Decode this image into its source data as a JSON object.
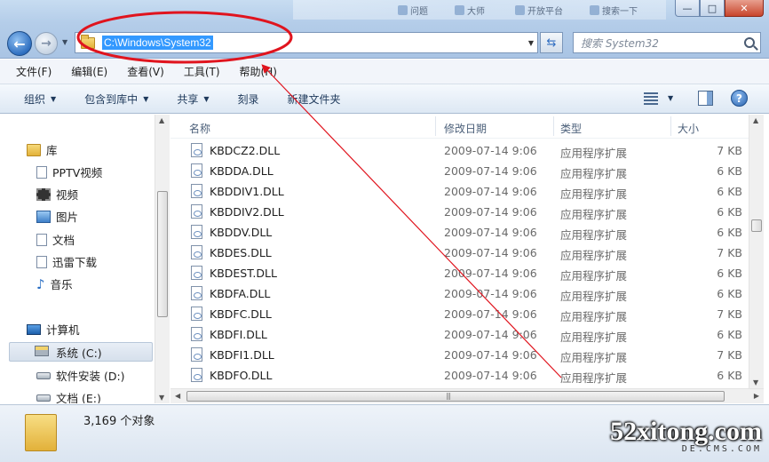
{
  "titlebar": {
    "blur_tabs": [
      "问题",
      "大师",
      "开放平台",
      "搜索一下"
    ],
    "min_glyph": "—",
    "max_glyph": "□",
    "close_glyph": "✕"
  },
  "address": {
    "path": "C:\\Windows\\System32",
    "search_placeholder": "搜索 System32"
  },
  "menu": [
    "文件(F)",
    "编辑(E)",
    "查看(V)",
    "工具(T)",
    "帮助(H)"
  ],
  "toolbar": {
    "organize": "组织",
    "include_library": "包含到库中",
    "share": "共享",
    "burn": "刻录",
    "new_folder": "新建文件夹",
    "help_glyph": "?"
  },
  "nav": {
    "libraries": "库",
    "items": [
      "PPTV视频",
      "视频",
      "图片",
      "文档",
      "迅雷下载",
      "音乐"
    ],
    "computer": "计算机",
    "drives": [
      "系统 (C:)",
      "软件安装 (D:)",
      "文档 (E:)"
    ]
  },
  "columns": {
    "name": "名称",
    "date": "修改日期",
    "type": "类型",
    "size": "大小"
  },
  "files": [
    {
      "name": "KBDCZ2.DLL",
      "date": "2009-07-14 9:06",
      "type": "应用程序扩展",
      "size": "7 KB"
    },
    {
      "name": "KBDDA.DLL",
      "date": "2009-07-14 9:06",
      "type": "应用程序扩展",
      "size": "6 KB"
    },
    {
      "name": "KBDDIV1.DLL",
      "date": "2009-07-14 9:06",
      "type": "应用程序扩展",
      "size": "6 KB"
    },
    {
      "name": "KBDDIV2.DLL",
      "date": "2009-07-14 9:06",
      "type": "应用程序扩展",
      "size": "6 KB"
    },
    {
      "name": "KBDDV.DLL",
      "date": "2009-07-14 9:06",
      "type": "应用程序扩展",
      "size": "6 KB"
    },
    {
      "name": "KBDES.DLL",
      "date": "2009-07-14 9:06",
      "type": "应用程序扩展",
      "size": "7 KB"
    },
    {
      "name": "KBDEST.DLL",
      "date": "2009-07-14 9:06",
      "type": "应用程序扩展",
      "size": "6 KB"
    },
    {
      "name": "KBDFA.DLL",
      "date": "2009-07-14 9:06",
      "type": "应用程序扩展",
      "size": "6 KB"
    },
    {
      "name": "KBDFC.DLL",
      "date": "2009-07-14 9:06",
      "type": "应用程序扩展",
      "size": "7 KB"
    },
    {
      "name": "KBDFI.DLL",
      "date": "2009-07-14 9:06",
      "type": "应用程序扩展",
      "size": "6 KB"
    },
    {
      "name": "KBDFI1.DLL",
      "date": "2009-07-14 9:06",
      "type": "应用程序扩展",
      "size": "7 KB"
    },
    {
      "name": "KBDFO.DLL",
      "date": "2009-07-14 9:06",
      "type": "应用程序扩展",
      "size": "6 KB"
    }
  ],
  "status": {
    "count": "3,169 个对象"
  },
  "watermark": {
    "main": "52xitong.com",
    "sub": "DE.CMS.COM"
  },
  "colors": {
    "selection": "#3399ff",
    "annotation": "#e0141e"
  }
}
